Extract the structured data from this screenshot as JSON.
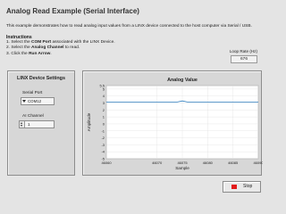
{
  "header": {
    "title": "Analog Read Example (Serial Interface)",
    "description": "This example demonstrates how to read analog input values from a LINX device connected to the host computer via Serial / USB."
  },
  "instructions": {
    "title": "Instructions",
    "step1_pre": "1. Select the ",
    "step1_bold": "COM Port",
    "step1_post": " associated with the LINX Device.",
    "step2_pre": "2. Select the ",
    "step2_bold": "Analog Channel",
    "step2_post": " to read.",
    "step3_pre": "3. Click the ",
    "step3_bold": "Run Arrow",
    "step3_post": "."
  },
  "loop_rate": {
    "label": "Loop Rate (Hz)",
    "value": "676"
  },
  "device_settings": {
    "title": "LINX Device Settings",
    "serial_port_label": "Serial Port",
    "serial_port_value": "COM12",
    "ai_channel_label": "AI Channel",
    "ai_channel_value": "1"
  },
  "stop_button": {
    "label": "Stop"
  },
  "colors": {
    "trace": "#2f7fc1",
    "stop_icon": "#e21b1b"
  },
  "chart_data": {
    "type": "line",
    "title": "Analog Value",
    "xlabel": "Sample",
    "ylabel": "Amplitude",
    "xlim": [
      46060,
      46090
    ],
    "ylim": [
      -5,
      5.5
    ],
    "x_ticks": [
      "46060",
      "46070",
      "46075",
      "46080",
      "46085",
      "46090"
    ],
    "y_ticks": [
      "5.5",
      "5",
      "4",
      "3",
      "2",
      "1",
      "0",
      "-1",
      "-2",
      "-3",
      "-4",
      "-5"
    ],
    "grid": true,
    "series": [
      {
        "x": [
          46060,
          46065,
          46070,
          46074,
          46075,
          46076,
          46080,
          46085,
          46090
        ],
        "values": [
          3.15,
          3.15,
          3.15,
          3.15,
          3.3,
          3.15,
          3.15,
          3.15,
          3.15
        ]
      }
    ]
  }
}
